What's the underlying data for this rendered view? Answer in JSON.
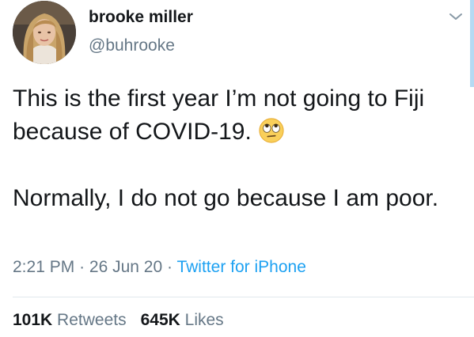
{
  "author": {
    "display_name": "brooke miller",
    "handle": "@buhrooke"
  },
  "tweet": {
    "paragraph_1": "This is the first year I’m not going to Fiji because of COVID-19.",
    "emoji": "rolling-eyes-emoji",
    "paragraph_2": "Normally, I do not go because I am poor."
  },
  "meta": {
    "time": "2:21 PM",
    "separator": "·",
    "date": "26 Jun 20",
    "source": "Twitter for iPhone"
  },
  "stats": {
    "retweets_count": "101K",
    "retweets_label": "Retweets",
    "likes_count": "645K",
    "likes_label": "Likes"
  },
  "colors": {
    "text": "#14171a",
    "secondary": "#657786",
    "link": "#1da1f2",
    "divider": "#e1e8ed"
  }
}
